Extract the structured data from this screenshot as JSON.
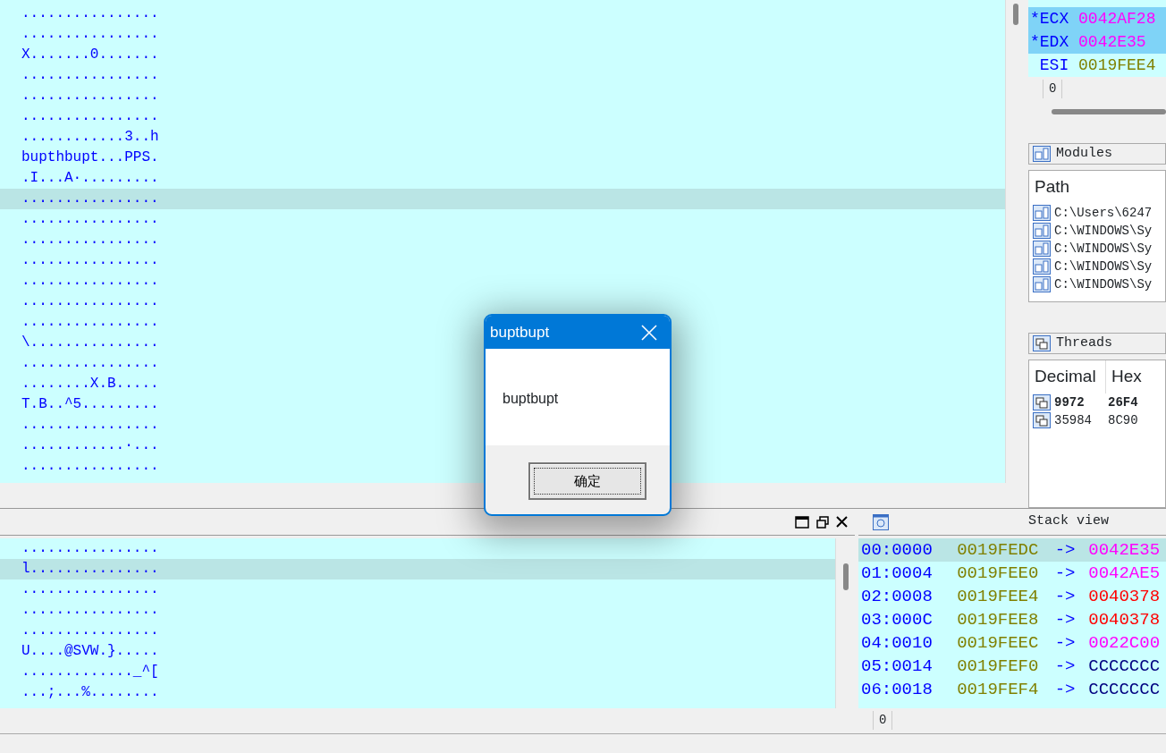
{
  "hex_view_top": {
    "rows": [
      {
        "text": "................",
        "selected": false
      },
      {
        "text": "................",
        "selected": false
      },
      {
        "text": "X.......0.......",
        "selected": false
      },
      {
        "text": "................",
        "selected": false
      },
      {
        "text": "................",
        "selected": false
      },
      {
        "text": "................",
        "selected": false
      },
      {
        "text": "............3..h",
        "selected": false
      },
      {
        "text": "bupthbupt...PPS.",
        "selected": false
      },
      {
        "text": ".I...A·.........",
        "selected": false
      },
      {
        "text": "................",
        "selected": true
      },
      {
        "text": "................",
        "selected": false
      },
      {
        "text": "................",
        "selected": false
      },
      {
        "text": "................",
        "selected": false
      },
      {
        "text": "................",
        "selected": false
      },
      {
        "text": "................",
        "selected": false
      },
      {
        "text": "................",
        "selected": false
      },
      {
        "text": "\\...............",
        "selected": false
      },
      {
        "text": "................",
        "selected": false
      },
      {
        "text": "........X.B.....",
        "selected": false
      },
      {
        "text": "T.B..^5.........",
        "selected": false
      },
      {
        "text": "................",
        "selected": false
      },
      {
        "text": "............·...",
        "selected": false
      },
      {
        "text": "................",
        "selected": false
      }
    ]
  },
  "registers": {
    "rows": [
      {
        "mark": "*",
        "name": "ECX",
        "value": "0042AF28",
        "modified": true,
        "color": "#ff00ff"
      },
      {
        "mark": "*",
        "name": "EDX",
        "value": "0042E35",
        "modified": true,
        "color": "#ff00ff"
      },
      {
        "name": "ESI",
        "value": "0019FEE4",
        "modified": false,
        "color": "#808000"
      }
    ],
    "status": "0"
  },
  "modules": {
    "title": "Modules",
    "column": "Path",
    "rows": [
      {
        "path": "C:\\Users\\6247"
      },
      {
        "path": "C:\\WINDOWS\\Sy"
      },
      {
        "path": "C:\\WINDOWS\\Sy"
      },
      {
        "path": "C:\\WINDOWS\\Sy"
      },
      {
        "path": "C:\\WINDOWS\\Sy"
      }
    ]
  },
  "threads": {
    "title": "Threads",
    "columns": [
      "Decimal",
      "Hex"
    ],
    "rows": [
      {
        "decimal": "9972",
        "hex": "26F4",
        "selected": true
      },
      {
        "decimal": "35984",
        "hex": "8C90",
        "selected": false
      }
    ]
  },
  "hex_view_bottom": {
    "rows": [
      {
        "text": "................",
        "selected": false
      },
      {
        "text": "l...............",
        "selected": true
      },
      {
        "text": "................",
        "selected": false
      },
      {
        "text": "................",
        "selected": false
      },
      {
        "text": "................",
        "selected": false
      },
      {
        "text": "U....@SVW.}.....",
        "selected": false
      },
      {
        "text": "............._^[",
        "selected": false
      },
      {
        "text": "...;...%........",
        "selected": false
      }
    ]
  },
  "stack_view": {
    "title": "Stack view",
    "rows": [
      {
        "offset": "00:0000",
        "address": "0019FEDC",
        "arrow": "->",
        "value": "0042E35",
        "color": "#ff00ff",
        "selected": true
      },
      {
        "offset": "01:0004",
        "address": "0019FEE0",
        "arrow": "->",
        "value": "0042AE5",
        "color": "#ff00ff",
        "selected": false
      },
      {
        "offset": "02:0008",
        "address": "0019FEE4",
        "arrow": "->",
        "value": "0040378",
        "color": "#ff0000",
        "selected": false
      },
      {
        "offset": "03:000C",
        "address": "0019FEE8",
        "arrow": "->",
        "value": "0040378",
        "color": "#ff0000",
        "selected": false
      },
      {
        "offset": "04:0010",
        "address": "0019FEEC",
        "arrow": "->",
        "value": "0022C00",
        "color": "#ff00ff",
        "selected": false
      },
      {
        "offset": "05:0014",
        "address": "0019FEF0",
        "arrow": "->",
        "value": "CCCCCCC",
        "color": "#000080",
        "selected": false
      },
      {
        "offset": "06:0018",
        "address": "0019FEF4",
        "arrow": "->",
        "value": "CCCCCCC",
        "color": "#000080",
        "selected": false
      }
    ],
    "status": "0"
  },
  "dialog": {
    "title": "buptbupt",
    "message": "buptbupt",
    "button": "确定"
  }
}
